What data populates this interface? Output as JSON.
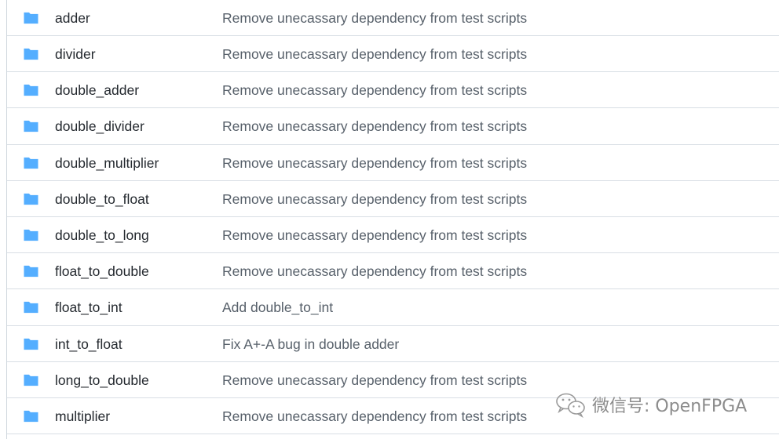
{
  "file_list": {
    "rows": [
      {
        "name": "adder",
        "commit_message": "Remove unecassary dependency from test scripts",
        "icon": "folder-icon"
      },
      {
        "name": "divider",
        "commit_message": "Remove unecassary dependency from test scripts",
        "icon": "folder-icon"
      },
      {
        "name": "double_adder",
        "commit_message": "Remove unecassary dependency from test scripts",
        "icon": "folder-icon"
      },
      {
        "name": "double_divider",
        "commit_message": "Remove unecassary dependency from test scripts",
        "icon": "folder-icon"
      },
      {
        "name": "double_multiplier",
        "commit_message": "Remove unecassary dependency from test scripts",
        "icon": "folder-icon"
      },
      {
        "name": "double_to_float",
        "commit_message": "Remove unecassary dependency from test scripts",
        "icon": "folder-icon"
      },
      {
        "name": "double_to_long",
        "commit_message": "Remove unecassary dependency from test scripts",
        "icon": "folder-icon"
      },
      {
        "name": "float_to_double",
        "commit_message": "Remove unecassary dependency from test scripts",
        "icon": "folder-icon"
      },
      {
        "name": "float_to_int",
        "commit_message": "Add double_to_int",
        "icon": "folder-icon"
      },
      {
        "name": "int_to_float",
        "commit_message": "Fix A+-A bug in double adder",
        "icon": "folder-icon"
      },
      {
        "name": "long_to_double",
        "commit_message": "Remove unecassary dependency from test scripts",
        "icon": "folder-icon"
      },
      {
        "name": "multiplier",
        "commit_message": "Remove unecassary dependency from test scripts",
        "icon": "folder-icon"
      }
    ]
  },
  "watermark": {
    "text": "微信号: OpenFPGA",
    "icon": "wechat-icon"
  },
  "colors": {
    "folder": "#54aeff",
    "name_text": "#24292f",
    "message_text": "#57606a",
    "divider": "#d8dee4"
  }
}
